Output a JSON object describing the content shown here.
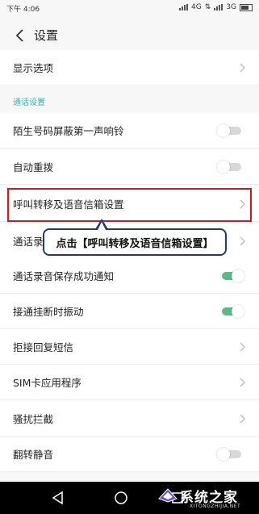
{
  "status_bar": {
    "time": "下午 4:06",
    "network_1": "4G",
    "network_2": "3G"
  },
  "header": {
    "title": "设置"
  },
  "section_call": "通话设置",
  "rows": [
    {
      "label": "显示选项",
      "control": "chevron"
    },
    {
      "label": "陌生号码屏蔽第一声响铃",
      "control": "toggle",
      "on": false
    },
    {
      "label": "自动重拨",
      "control": "toggle",
      "on": false
    },
    {
      "label": "呼叫转移及语音信箱设置",
      "control": "chevron"
    },
    {
      "label": "通话录",
      "control": "chevron"
    },
    {
      "label": "通话录音保存成功通知",
      "control": "toggle",
      "on": true
    },
    {
      "label": "接通挂断时振动",
      "control": "toggle",
      "on": true
    },
    {
      "label": "拒接回复短信",
      "control": "chevron"
    },
    {
      "label": "SIM卡应用程序",
      "control": "chevron"
    },
    {
      "label": "骚扰拦截",
      "control": "chevron"
    },
    {
      "label": "翻转静音",
      "control": "toggle",
      "on": false
    }
  ],
  "annotation": {
    "callout_text": "点击【呼叫转移及语音信箱设置】",
    "highlight_color": "#d4161b",
    "callout_border_color": "#1f3e6b"
  },
  "colors": {
    "accent": "#3fb0a5",
    "toggle_on": "#5ab88b"
  },
  "nav_bar": {
    "icons": [
      "back-icon",
      "home-icon",
      "recents-icon"
    ]
  },
  "watermark": {
    "text": "系统之家",
    "url": "XITONGZHIJIA.NET"
  }
}
